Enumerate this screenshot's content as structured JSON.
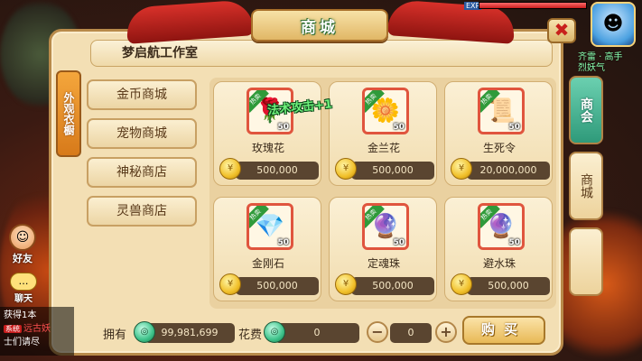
{
  "shop": {
    "title": "商城",
    "close_label": "✖",
    "studio_name": "梦启航工作室",
    "side_tab": "外观衣橱",
    "categories": [
      "金币商城",
      "宠物商城",
      "神秘商店",
      "灵兽商店"
    ],
    "floating_text": "法术攻击+1",
    "hot_label": "热卖",
    "items": [
      {
        "name": "玫瑰花",
        "qty": "50",
        "price": "500,000",
        "icon": "rose-icon",
        "glyph": "🌹"
      },
      {
        "name": "金兰花",
        "qty": "50",
        "price": "500,000",
        "icon": "orchid-icon",
        "glyph": "🌼"
      },
      {
        "name": "生死令",
        "qty": "50",
        "price": "20,000,000",
        "icon": "token-icon",
        "glyph": "📜"
      },
      {
        "name": "金刚石",
        "qty": "50",
        "price": "500,000",
        "icon": "diamond-stone-icon",
        "glyph": "💎"
      },
      {
        "name": "定魂珠",
        "qty": "50",
        "price": "500,000",
        "icon": "blue-orb-icon",
        "glyph": "🔮"
      },
      {
        "name": "避水珠",
        "qty": "50",
        "price": "500,000",
        "icon": "purple-orb-icon",
        "glyph": "🔮"
      }
    ],
    "owned_label": "拥有",
    "owned_value": "99,981,699",
    "cost_label": "花费",
    "cost_value": "0",
    "quantity": "0",
    "minus_label": "−",
    "plus_label": "+",
    "buy_label": "购买",
    "right_tabs": [
      "商会",
      "商城",
      ""
    ]
  },
  "hud": {
    "friend_label": "好友",
    "chat_label": "聊天",
    "chat_lines": [
      {
        "text": "获得1本"
      },
      {
        "tag": "系统",
        "text": "远古妖"
      },
      {
        "text": "士们请尽"
      }
    ],
    "exp_label": "EXP",
    "player_name": "齐雷 · 高手",
    "player_sub": "烈妖气"
  },
  "colors": {
    "panel_bg": "#f3dfb4",
    "accent_green": "#2f9a3a",
    "price_bar": "#5a4530",
    "title_red": "#c8201c"
  }
}
